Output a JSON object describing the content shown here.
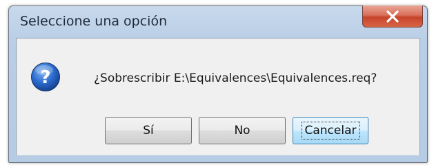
{
  "window": {
    "title": "Seleccione una opción"
  },
  "icons": {
    "close": "close-icon",
    "question": "question-icon"
  },
  "dialog": {
    "message": "¿Sobrescribir E:\\Equivalences\\Equivalences.req?"
  },
  "buttons": {
    "yes": "Sí",
    "no": "No",
    "cancel": "Cancelar"
  },
  "colors": {
    "close_button": "#c7442a",
    "question_icon": "#1f5cb4",
    "default_button_border": "#3c7fb1"
  }
}
